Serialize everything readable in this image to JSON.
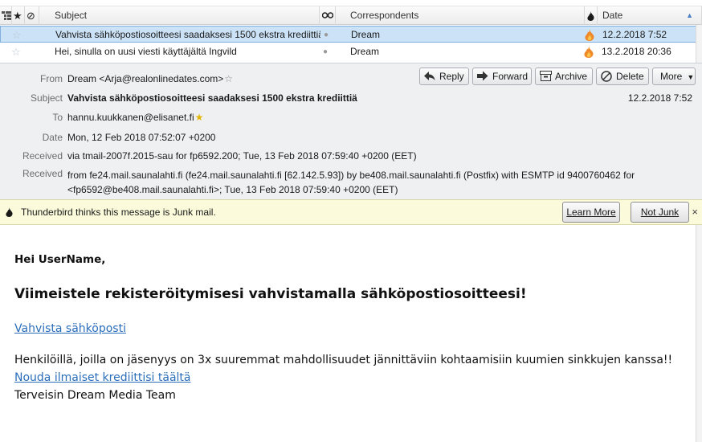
{
  "message_list": {
    "columns": {
      "subject": "Subject",
      "correspondents": "Correspondents",
      "date": "Date"
    },
    "rows": [
      {
        "subject": "Vahvista sähköpostiosoitteesi saadaksesi 1500 ekstra krediittiä",
        "correspondent": "Dream",
        "date": "12.2.2018 7:52",
        "selected": true
      },
      {
        "subject": "Hei, sinulla on uusi viesti käyttäjältä Ingvild",
        "correspondent": "Dream",
        "date": "13.2.2018 20:36",
        "selected": false
      }
    ]
  },
  "toolbar": {
    "reply": "Reply",
    "forward": "Forward",
    "archive": "Archive",
    "delete": "Delete",
    "more": "More"
  },
  "headers": {
    "from_label": "From",
    "from_value": "Dream <Arja@realonlinedates.com>",
    "subject_label": "Subject",
    "subject_value": "Vahvista sähköpostiosoitteesi saadaksesi 1500 ekstra krediittiä",
    "date_short": "12.2.2018 7:52",
    "to_label": "To",
    "to_value": "hannu.kuukkanen@elisanet.fi",
    "date_label": "Date",
    "date_value": "Mon, 12 Feb 2018 07:52:07 +0200",
    "received_label": "Received",
    "received_1": "via tmail-2007f.2015-sau for fp6592.200; Tue, 13 Feb 2018 07:59:40 +0200 (EET)",
    "received_2": "from fe24.mail.saunalahti.fi (fe24.mail.saunalahti.fi [62.142.5.93]) by be408.mail.saunalahti.fi (Postfix) with ESMTP id 9400760462 for <fp6592@be408.mail.saunalahti.fi>; Tue, 13 Feb 2018 07:59:40 +0200 (EET)"
  },
  "junk_bar": {
    "message": "Thunderbird thinks this message is Junk mail.",
    "learn_more": "Learn More",
    "not_junk": "Not Junk",
    "close": "×"
  },
  "body": {
    "greeting": "Hei UserName,",
    "headline": "Viimeistele rekisteröitymisesi vahvistamalla sähköpostiosoitteesi!",
    "confirm_link": "Vahvista sähköposti",
    "paragraph": "Henkilöillä, joilla on jäsenyys on 3x suuremmat mahdollisuudet jännittäviin kohtaamisiin kuumien sinkkujen kanssa!!",
    "credits_link": "Nouda ilmaiset krediittisi täältä",
    "signature": "Terveisin Dream Media Team"
  },
  "colors": {
    "selection": "#cce3f7",
    "link": "#2a6ebb",
    "junk_bar": "#fbfbdc",
    "flame": "#f0892a"
  }
}
